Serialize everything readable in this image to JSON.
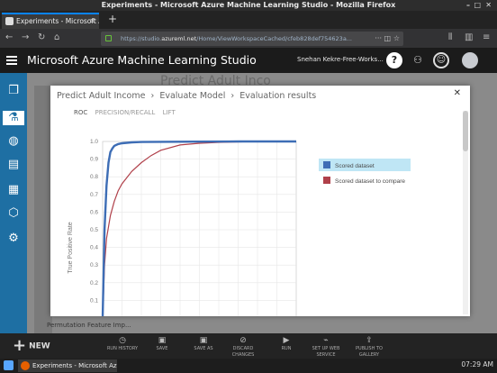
{
  "window": {
    "title": "Experiments - Microsoft Azure Machine Learning Studio - Mozilla Firefox"
  },
  "browser": {
    "tab_label": "Experiments - Microsoft Azu",
    "url_prefix": "https://studio.",
    "url_host": "azureml.net",
    "url_rest": "/Home/ViewWorkspaceCached/cfeb828def754623a..."
  },
  "app": {
    "title": "Microsoft Azure Machine Learning Studio",
    "user": "Snehan Kekre-Free-Works..."
  },
  "workspace": {
    "bg_title": "Predict Adult Inco",
    "bg_item": "Permutation Feature Imp..."
  },
  "modal": {
    "breadcrumb": [
      "Predict Adult Income",
      "Evaluate Model",
      "Evaluation results"
    ],
    "tabs": [
      "ROC",
      "PRECISION/RECALL",
      "LIFT"
    ]
  },
  "chart_data": {
    "type": "line",
    "ylabel": "True Positive Rate",
    "xlabel": "",
    "ylim": [
      0,
      1.0
    ],
    "xlim": [
      0,
      1.0
    ],
    "yticks": [
      "1.0",
      "0.9",
      "0.8",
      "0.7",
      "0.6",
      "0.5",
      "0.4",
      "0.3",
      "0.2",
      "0.1"
    ],
    "grid": true,
    "legend_position": "right",
    "series": [
      {
        "name": "Scored dataset",
        "color": "#3d6db5",
        "x": [
          0.0,
          0.01,
          0.02,
          0.03,
          0.04,
          0.05,
          0.06,
          0.08,
          0.1,
          0.15,
          0.2,
          0.3,
          0.5,
          0.7,
          1.0
        ],
        "y": [
          0.0,
          0.5,
          0.75,
          0.88,
          0.94,
          0.96,
          0.975,
          0.985,
          0.99,
          0.995,
          0.997,
          0.998,
          0.999,
          1.0,
          1.0
        ]
      },
      {
        "name": "Scored dataset to compare",
        "color": "#b0404a",
        "x": [
          0.0,
          0.01,
          0.02,
          0.04,
          0.06,
          0.08,
          0.1,
          0.15,
          0.2,
          0.25,
          0.3,
          0.4,
          0.5,
          0.6,
          0.8,
          1.0
        ],
        "y": [
          0.0,
          0.3,
          0.45,
          0.58,
          0.66,
          0.72,
          0.76,
          0.83,
          0.88,
          0.92,
          0.95,
          0.98,
          0.99,
          0.995,
          1.0,
          1.0
        ]
      }
    ]
  },
  "toolbar": {
    "new_label": "NEW",
    "items": [
      "RUN HISTORY",
      "SAVE",
      "SAVE AS",
      "DISCARD CHANGES",
      "RUN",
      "SET UP WEB SERVICE",
      "PUBLISH TO GALLERY"
    ]
  },
  "taskbar": {
    "app_label": "Experiments - Microsoft Azu",
    "clock": "07:29 AM"
  }
}
